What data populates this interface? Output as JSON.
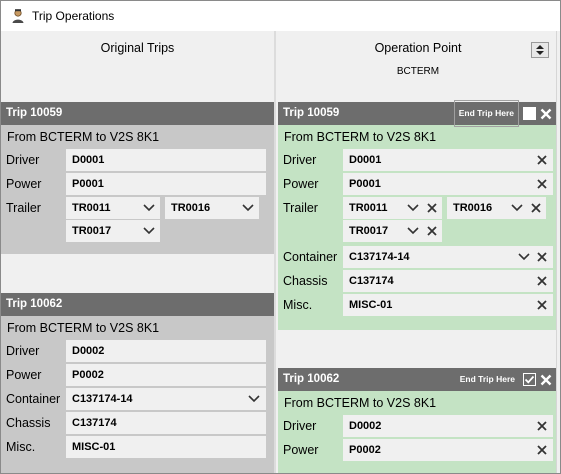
{
  "window": {
    "title": "Trip Operations"
  },
  "left": {
    "header": "Original Trips",
    "trips": [
      {
        "title": "Trip 10059",
        "route": "From BCTERM to V2S 8K1",
        "driver_label": "Driver",
        "driver": "D0001",
        "power_label": "Power",
        "power": "P0001",
        "trailer_label": "Trailer",
        "trailers": [
          "TR0011",
          "TR0016",
          "TR0017"
        ]
      },
      {
        "title": "Trip 10062",
        "route": "From BCTERM to V2S 8K1",
        "driver_label": "Driver",
        "driver": "D0002",
        "power_label": "Power",
        "power": "P0002",
        "container_label": "Container",
        "container": "C137174-14",
        "chassis_label": "Chassis",
        "chassis": "C137174",
        "misc_label": "Misc.",
        "misc": "MISC-01"
      }
    ]
  },
  "right": {
    "header": "Operation Point",
    "subheader": "BCTERM",
    "trips": [
      {
        "title": "Trip 10059",
        "end_trip_label": "End Trip Here",
        "end_trip_checked": false,
        "route": "From BCTERM to V2S 8K1",
        "driver_label": "Driver",
        "driver": "D0001",
        "power_label": "Power",
        "power": "P0001",
        "trailer_label": "Trailer",
        "trailers": [
          "TR0011",
          "TR0016",
          "TR0017"
        ],
        "container_label": "Container",
        "container": "C137174-14",
        "chassis_label": "Chassis",
        "chassis": "C137174",
        "misc_label": "Misc.",
        "misc": "MISC-01"
      },
      {
        "title": "Trip 10062",
        "end_trip_label": "End Trip Here",
        "end_trip_checked": true,
        "route": "From BCTERM to V2S 8K1",
        "driver_label": "Driver",
        "driver": "D0002",
        "power_label": "Power",
        "power": "P0002"
      }
    ]
  },
  "colors": {
    "trip_header": "#6d6d6d",
    "original_body": "#c8c8c8",
    "operation_body": "#c4e3c4"
  }
}
